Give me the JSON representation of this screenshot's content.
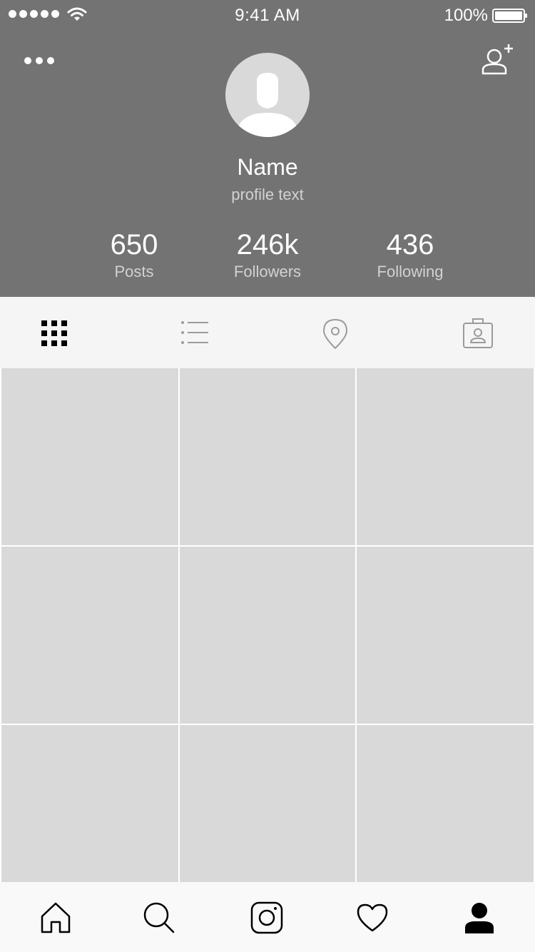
{
  "status_bar": {
    "time": "9:41 AM",
    "battery": "100%",
    "signal_icon": "signal-dots-icon",
    "wifi_icon": "wifi-icon",
    "battery_icon": "battery-icon"
  },
  "header": {
    "menu_icon": "more-icon",
    "add_user_icon": "add-user-icon",
    "avatar_icon": "person-silhouette-icon"
  },
  "profile": {
    "name": "Name",
    "text": "profile text"
  },
  "stats": [
    {
      "value": "650",
      "label": "Posts"
    },
    {
      "value": "246k",
      "label": "Followers"
    },
    {
      "value": "436",
      "label": "Following"
    }
  ],
  "view_tabs": [
    {
      "icon": "grid-icon",
      "active": true
    },
    {
      "icon": "list-icon",
      "active": false
    },
    {
      "icon": "location-pin-icon",
      "active": false
    },
    {
      "icon": "tagged-person-icon",
      "active": false
    }
  ],
  "grid": {
    "count": 9
  },
  "bottom_nav": [
    {
      "icon": "home-icon",
      "active": false
    },
    {
      "icon": "search-icon",
      "active": false
    },
    {
      "icon": "camera-icon",
      "active": false
    },
    {
      "icon": "heart-icon",
      "active": false
    },
    {
      "icon": "profile-icon",
      "active": true
    }
  ],
  "colors": {
    "header_bg": "#737373",
    "tab_bg": "#f5f5f5",
    "placeholder": "#d9d9d9",
    "icon_active": "#000000",
    "icon_inactive": "#9b9b9b",
    "text_primary": "#ffffff",
    "text_secondary": "#d2d2d2"
  }
}
